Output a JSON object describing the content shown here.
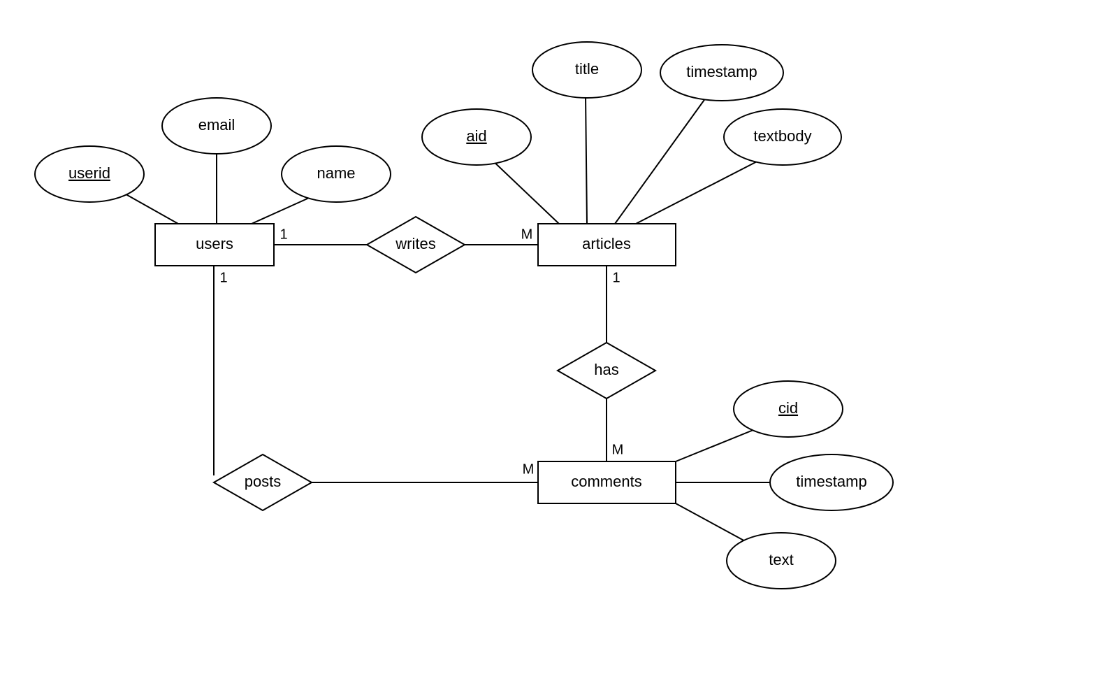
{
  "entities": {
    "users": {
      "label": "users",
      "attrs": {
        "userid": "userid",
        "email": "email",
        "name": "name"
      },
      "keyAttr": "userid"
    },
    "articles": {
      "label": "articles",
      "attrs": {
        "aid": "aid",
        "title": "title",
        "timestamp": "timestamp",
        "textbody": "textbody"
      },
      "keyAttr": "aid"
    },
    "comments": {
      "label": "comments",
      "attrs": {
        "cid": "cid",
        "timestamp": "timestamp",
        "text": "text"
      },
      "keyAttr": "cid"
    }
  },
  "relationships": {
    "writes": {
      "label": "writes",
      "left": {
        "entity": "users",
        "card": "1"
      },
      "right": {
        "entity": "articles",
        "card": "M"
      }
    },
    "has": {
      "label": "has",
      "top": {
        "entity": "articles",
        "card": "1"
      },
      "bottom": {
        "entity": "comments",
        "card": "M"
      }
    },
    "posts": {
      "label": "posts",
      "left": {
        "entity": "users",
        "card": "1"
      },
      "right": {
        "entity": "comments",
        "card": "M"
      }
    }
  }
}
